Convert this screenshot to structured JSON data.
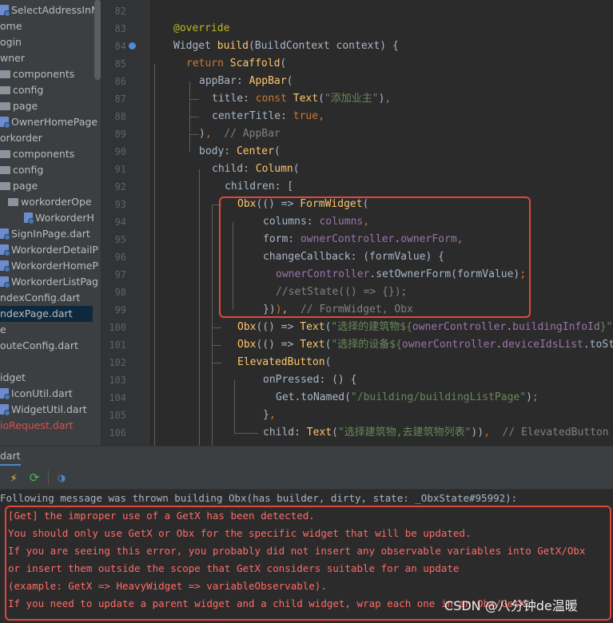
{
  "project_tree": {
    "items": [
      {
        "label": "SelectAddressInM",
        "kind": "file",
        "indent": 0
      },
      {
        "label": "ome",
        "kind": "none",
        "indent": 0
      },
      {
        "label": "ogin",
        "kind": "none",
        "indent": 0
      },
      {
        "label": "wner",
        "kind": "none",
        "indent": 0
      },
      {
        "label": "components",
        "kind": "folder",
        "indent": 0
      },
      {
        "label": "config",
        "kind": "folder",
        "indent": 0
      },
      {
        "label": "page",
        "kind": "folder",
        "indent": 0
      },
      {
        "label": "OwnerHomePage",
        "kind": "file",
        "indent": 0
      },
      {
        "label": "orkorder",
        "kind": "none",
        "indent": 0
      },
      {
        "label": "components",
        "kind": "folder",
        "indent": 0
      },
      {
        "label": "config",
        "kind": "folder",
        "indent": 0
      },
      {
        "label": "page",
        "kind": "folder",
        "indent": 0
      },
      {
        "label": "workorderOpe",
        "kind": "folder",
        "indent": 1
      },
      {
        "label": "WorkorderH",
        "kind": "file",
        "indent": 2
      },
      {
        "label": "SignInPage.dart",
        "kind": "file",
        "indent": 0
      },
      {
        "label": "WorkorderDetailP",
        "kind": "file",
        "indent": 0
      },
      {
        "label": "WorkorderHomeP",
        "kind": "file",
        "indent": 0
      },
      {
        "label": "WorkorderListPag",
        "kind": "file",
        "indent": 0
      },
      {
        "label": "ndexConfig.dart",
        "kind": "none",
        "indent": 0
      },
      {
        "label": "ndexPage.dart",
        "kind": "none",
        "indent": 0,
        "selected": true
      },
      {
        "label": "e",
        "kind": "none",
        "indent": 0
      },
      {
        "label": "outeConfig.dart",
        "kind": "none",
        "indent": 0
      },
      {
        "label": "",
        "kind": "none",
        "indent": 0
      },
      {
        "label": "idget",
        "kind": "none",
        "indent": 0
      },
      {
        "label": "IconUtil.dart",
        "kind": "file",
        "indent": 0
      },
      {
        "label": "WidgetUtil.dart",
        "kind": "file",
        "indent": 0
      },
      {
        "label": "ioRequest.dart",
        "kind": "none",
        "indent": 0,
        "error": true
      }
    ]
  },
  "editor": {
    "line_numbers": [
      "82",
      "83",
      "84",
      "85",
      "86",
      "87",
      "88",
      "89",
      "90",
      "91",
      "92",
      "93",
      "94",
      "95",
      "96",
      "97",
      "98",
      "99",
      "100",
      "101",
      "102",
      "103",
      "104",
      "105",
      "106"
    ],
    "lines": [
      {
        "indent": 0,
        "tokens": []
      },
      {
        "indent": 0,
        "tokens": [
          {
            "t": "@override",
            "c": "ann"
          }
        ]
      },
      {
        "indent": 0,
        "tokens": [
          {
            "t": "Widget "
          },
          {
            "t": "build",
            "c": "fn"
          },
          {
            "t": "(BuildContext context) {"
          }
        ]
      },
      {
        "indent": 1,
        "tokens": [
          {
            "t": "return ",
            "c": "kw"
          },
          {
            "t": "Scaffold",
            "c": "fn"
          },
          {
            "t": "("
          }
        ]
      },
      {
        "indent": 2,
        "tokens": [
          {
            "t": "appBar: "
          },
          {
            "t": "AppBar",
            "c": "fn"
          },
          {
            "t": "("
          }
        ]
      },
      {
        "indent": 3,
        "tokens": [
          {
            "t": "title: "
          },
          {
            "t": "const ",
            "c": "kw"
          },
          {
            "t": "Text",
            "c": "fn"
          },
          {
            "t": "("
          },
          {
            "t": "\"添加业主\"",
            "c": "str"
          },
          {
            "t": ")"
          },
          {
            "t": ",",
            "c": "kw"
          }
        ]
      },
      {
        "indent": 3,
        "tokens": [
          {
            "t": "centerTitle: "
          },
          {
            "t": "true",
            "c": "kw"
          },
          {
            "t": ",",
            "c": "kw"
          }
        ]
      },
      {
        "indent": 2,
        "tokens": [
          {
            "t": ")"
          },
          {
            "t": ",",
            "c": "kw"
          },
          {
            "t": "  // AppBar",
            "c": "cm"
          }
        ]
      },
      {
        "indent": 2,
        "tokens": [
          {
            "t": "body: "
          },
          {
            "t": "Center",
            "c": "fn"
          },
          {
            "t": "("
          }
        ]
      },
      {
        "indent": 3,
        "tokens": [
          {
            "t": "child: "
          },
          {
            "t": "Column",
            "c": "fn"
          },
          {
            "t": "("
          }
        ]
      },
      {
        "indent": 4,
        "tokens": [
          {
            "t": "children: ["
          }
        ]
      },
      {
        "indent": 5,
        "tokens": [
          {
            "t": "Obx",
            "c": "fn"
          },
          {
            "t": "(() => "
          },
          {
            "t": "FormWidget",
            "c": "fn"
          },
          {
            "t": "("
          }
        ]
      },
      {
        "indent": 7,
        "tokens": [
          {
            "t": "columns: "
          },
          {
            "t": "columns",
            "c": "fld"
          },
          {
            "t": ",",
            "c": "kw"
          }
        ]
      },
      {
        "indent": 7,
        "tokens": [
          {
            "t": "form: "
          },
          {
            "t": "ownerController",
            "c": "fld"
          },
          {
            "t": "."
          },
          {
            "t": "ownerForm",
            "c": "fld"
          },
          {
            "t": ",",
            "c": "kw"
          }
        ]
      },
      {
        "indent": 7,
        "tokens": [
          {
            "t": "changeCallback: (formValue) {"
          }
        ]
      },
      {
        "indent": 8,
        "tokens": [
          {
            "t": "ownerController",
            "c": "fld"
          },
          {
            "t": ".setOwnerForm(formValue)"
          },
          {
            "t": ";",
            "c": "kw"
          }
        ]
      },
      {
        "indent": 8,
        "tokens": [
          {
            "t": "//setState(() => {});",
            "c": "cm"
          }
        ]
      },
      {
        "indent": 7,
        "tokens": [
          {
            "t": "})"
          },
          {
            "t": ")",
            "c": "kw"
          },
          {
            "t": ","
          },
          {
            "t": "  // FormWidget, Obx",
            "c": "cm"
          }
        ]
      },
      {
        "indent": 5,
        "tokens": [
          {
            "t": "Obx",
            "c": "fn"
          },
          {
            "t": "(() => "
          },
          {
            "t": "Text",
            "c": "fn"
          },
          {
            "t": "("
          },
          {
            "t": "\"选择的建筑物${",
            "c": "str"
          },
          {
            "t": "ownerController",
            "c": "fld"
          },
          {
            "t": "."
          },
          {
            "t": "buildingInfoId",
            "c": "fld"
          },
          {
            "t": "}\")",
            "c": "str"
          }
        ]
      },
      {
        "indent": 5,
        "tokens": [
          {
            "t": "Obx",
            "c": "fn"
          },
          {
            "t": "(() => "
          },
          {
            "t": "Text",
            "c": "fn"
          },
          {
            "t": "("
          },
          {
            "t": "\"选择的设备${",
            "c": "str"
          },
          {
            "t": "ownerController",
            "c": "fld"
          },
          {
            "t": "."
          },
          {
            "t": "deviceIdsList",
            "c": "fld"
          },
          {
            "t": ".toSt"
          }
        ]
      },
      {
        "indent": 5,
        "tokens": [
          {
            "t": "ElevatedButton",
            "c": "fn"
          },
          {
            "t": "("
          }
        ]
      },
      {
        "indent": 7,
        "tokens": [
          {
            "t": "onPressed: () {"
          }
        ]
      },
      {
        "indent": 8,
        "tokens": [
          {
            "t": "Get.toNamed("
          },
          {
            "t": "\"/building/buildingListPage\"",
            "c": "str"
          },
          {
            "t": ")"
          },
          {
            "t": ";",
            "c": "kw"
          }
        ]
      },
      {
        "indent": 7,
        "tokens": [
          {
            "t": "}"
          },
          {
            "t": ",",
            "c": "kw"
          }
        ]
      },
      {
        "indent": 7,
        "tokens": [
          {
            "t": "child: "
          },
          {
            "t": "Text",
            "c": "fn"
          },
          {
            "t": "("
          },
          {
            "t": "\"选择建筑物,去建筑物列表\"",
            "c": "str"
          },
          {
            "t": "))"
          },
          {
            "t": ",",
            "c": "kw"
          },
          {
            "t": "  // ElevatedButton",
            "c": "cm"
          }
        ]
      }
    ]
  },
  "run_panel": {
    "tab_label": "dart",
    "toolbar": [
      {
        "name": "hot-reload-icon",
        "glyph": "⚡",
        "color": "#f0c040"
      },
      {
        "name": "hot-restart-icon",
        "glyph": "⟳",
        "color": "#4fb34f"
      },
      {
        "name": "devtools-icon",
        "glyph": "◑",
        "color": "#4a88c7"
      }
    ]
  },
  "console": {
    "info": "Following message was thrown building Obx(has builder, dirty, state: _ObxState#95992):",
    "errors": [
      "[Get] the improper use of a GetX has been detected.",
      "You should only use GetX or Obx for the specific widget that will be updated.",
      "If you are seeing this error, you probably did not insert any observable variables into GetX/Obx",
      "or insert them outside the scope that GetX considers suitable for an update",
      "(example: GetX => HeavyWidget => variableObservable).",
      "If you need to update a parent widget and a child widget, wrap each one in an Obx/GetX."
    ]
  },
  "watermark": "CSDN @八分钟de温暖",
  "colors": {
    "editor_bg": "#2b2b2b",
    "keyword": "#cc7832",
    "function": "#ffc66d",
    "string": "#6a8759",
    "comment": "#808080",
    "field": "#9876aa",
    "annotation": "#bbb529",
    "error_text": "#ff6b68",
    "highlight_box": "#e0483a"
  }
}
